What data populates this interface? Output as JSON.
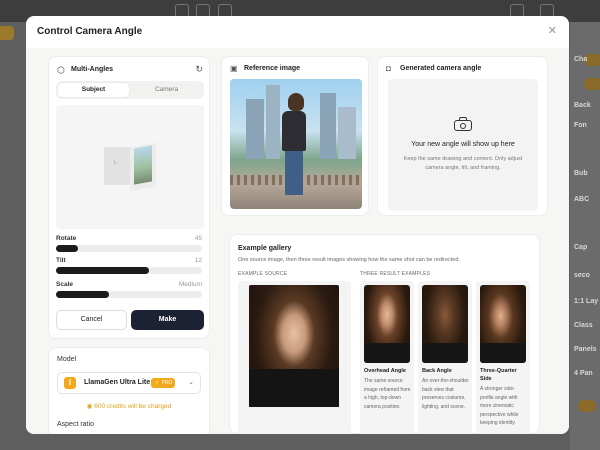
{
  "modal": {
    "title": "Control Camera Angle"
  },
  "multi_angles": {
    "title": "Multi-Angles",
    "tabs": [
      "Subject",
      "Camera"
    ],
    "active_tab": "Subject",
    "preview_face_label": "L",
    "sliders": [
      {
        "label": "Rotate",
        "value": "45",
        "fraction": 0.15
      },
      {
        "label": "Tilt",
        "value": "12",
        "fraction": 0.64
      },
      {
        "label": "Scale",
        "value": "Medium",
        "fraction": 0.36
      }
    ],
    "cancel_label": "Cancel",
    "make_label": "Make"
  },
  "model": {
    "label": "Model",
    "name": "LlamaGen Ultra Lite",
    "badge": "⚡ PRO",
    "credits": "600 credits will be charged",
    "aspect_label": "Aspect ratio"
  },
  "reference": {
    "title": "Reference image"
  },
  "generated": {
    "title": "Generated camera angle",
    "main": "Your new angle will show up here",
    "sub": "Keep the same drawing and content. Only adjust camera angle, tilt, and framing."
  },
  "gallery": {
    "title": "Example gallery",
    "subtitle": "One source image, then three result images showing how the same shot can be redirected.",
    "source_label": "EXAMPLE SOURCE",
    "results_label": "THREE RESULT EXAMPLES",
    "results": [
      {
        "title": "Overhead Angle",
        "desc": "The same source image reframed from a high, top-down camera position."
      },
      {
        "title": "Back Angle",
        "desc": "An over-the-shoulder back view that preserves costume, lighting, and scene."
      },
      {
        "title": "Three-Quarter Side",
        "desc": "A stronger side-profile angle with more cinematic perspective while keeping identity."
      }
    ]
  },
  "background_app": {
    "right_rows": [
      "Cha",
      "Back",
      "Fon",
      "Bub",
      "ABC",
      "Cap",
      "seco",
      "1:1 Lay",
      "Class",
      "Panels",
      "4 Pan"
    ]
  },
  "colors": {
    "accent": "#f2a81d",
    "primary_button": "#1c2233",
    "slider_fill": "#1b1b1b"
  },
  "icons": {
    "close": "close-icon",
    "cube": "cube-icon",
    "refresh": "refresh-icon",
    "image": "image-icon",
    "camera": "camera-icon",
    "chevron": "chevron-down-icon",
    "coin": "coin-icon"
  }
}
